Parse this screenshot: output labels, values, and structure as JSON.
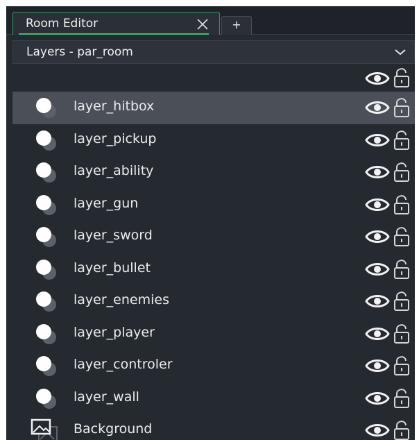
{
  "tab": {
    "title": "Room Editor",
    "add_label": "+"
  },
  "dropdown": {
    "label": "Layers - par_room"
  },
  "layers": [
    {
      "name": "layer_hitbox",
      "type": "instance",
      "selected": true
    },
    {
      "name": "layer_pickup",
      "type": "instance",
      "selected": false
    },
    {
      "name": "layer_ability",
      "type": "instance",
      "selected": false
    },
    {
      "name": "layer_gun",
      "type": "instance",
      "selected": false
    },
    {
      "name": "layer_sword",
      "type": "instance",
      "selected": false
    },
    {
      "name": "layer_bullet",
      "type": "instance",
      "selected": false
    },
    {
      "name": "layer_enemies",
      "type": "instance",
      "selected": false
    },
    {
      "name": "layer_player",
      "type": "instance",
      "selected": false
    },
    {
      "name": "layer_controler",
      "type": "instance",
      "selected": false
    },
    {
      "name": "layer_wall",
      "type": "instance",
      "selected": false
    },
    {
      "name": "Background",
      "type": "background",
      "selected": false
    }
  ],
  "colors": {
    "panel_bg": "#252a31",
    "selected_row": "#4a4f58",
    "tab_accent": "#3fbf6e"
  },
  "icons": {
    "visibility": "eye-icon",
    "lock": "unlocked-lock-icon",
    "instance_layer": "instance-layer-icon",
    "background_layer": "background-layer-icon",
    "close": "close-icon",
    "dropdown": "chevron-down-icon"
  }
}
